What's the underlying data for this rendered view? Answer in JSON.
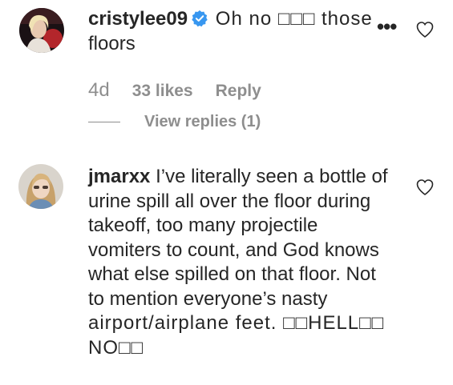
{
  "comments": [
    {
      "username": "cristylee09",
      "verified": true,
      "text_line1": "Oh no □□□ those",
      "text_line2": "floors",
      "time": "4d",
      "likes": "33 likes",
      "reply_label": "Reply",
      "view_replies": "View replies (1)",
      "avatar_icon": "avatar-photo"
    },
    {
      "username": "jmarxx",
      "verified": false,
      "text_lines": [
        "I’ve literally seen a bottle of",
        "urine spill all over the floor during",
        "takeoff, too many projectile",
        "vomiters to count, and God knows",
        "what else spilled on that floor. Not",
        "to mention everyone’s nasty",
        "airport/airplane feet. □□HELL□□",
        "NO□□"
      ],
      "avatar_icon": "avatar-photo"
    }
  ],
  "icons": {
    "more": "•••",
    "like": "heart-outline-icon",
    "verified": "verified-badge-icon"
  },
  "colors": {
    "text": "#262626",
    "muted": "#8e8e8e",
    "verified_blue": "#3897f0"
  }
}
